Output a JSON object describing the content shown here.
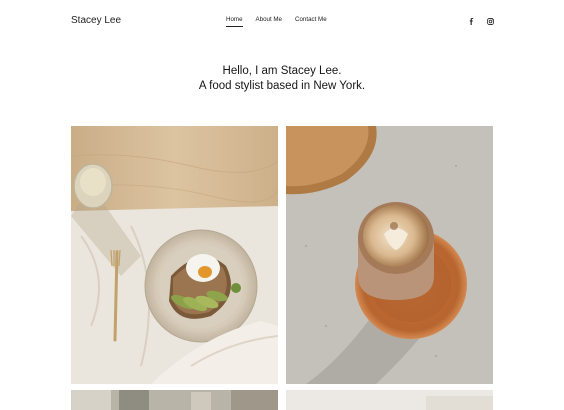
{
  "site": {
    "name": "Stacey Lee"
  },
  "nav": {
    "items": [
      "Home",
      "About Me",
      "Contact Me"
    ],
    "active": "Home"
  },
  "social": {
    "icons": [
      "facebook-icon",
      "instagram-icon"
    ]
  },
  "hero": {
    "line1": "Hello, I am Stacey Lee.",
    "line2": "A food stylist based in New York."
  },
  "gallery": {
    "images": [
      "avocado-toast-photo",
      "cappuccino-photo",
      "cafe-photo",
      "kitchen-photo"
    ]
  },
  "colors": {
    "text": "#1b1b1b",
    "background": "#ffffff"
  }
}
